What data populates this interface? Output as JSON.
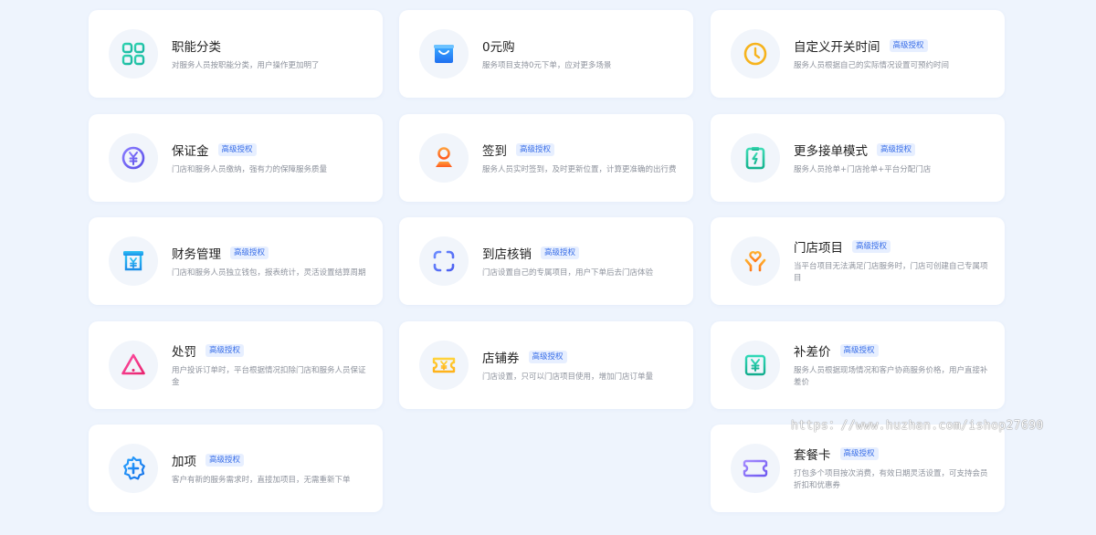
{
  "features": [
    {
      "title": "职能分类",
      "badge": "",
      "desc": "对服务人员按职能分类，用户操作更加明了",
      "icon": "grid-icon"
    },
    {
      "title": "0元购",
      "badge": "",
      "desc": "服务项目支持0元下单，应对更多场景",
      "icon": "bag-icon"
    },
    {
      "title": "自定义开关时间",
      "badge": "高级授权",
      "desc": "服务人员根据自己的实际情况设置可预约时间",
      "icon": "clock-icon"
    },
    {
      "title": "保证金",
      "badge": "高级授权",
      "desc": "门店和服务人员缴纳，强有力的保障服务质量",
      "icon": "yuan-coin-icon"
    },
    {
      "title": "签到",
      "badge": "高级授权",
      "desc": "服务人员实时签到，及时更新位置，计算更准确的出行费",
      "icon": "location-pin-icon"
    },
    {
      "title": "更多接单模式",
      "badge": "高级授权",
      "desc": "服务人员抢单+门店抢单+平台分配门店",
      "icon": "clipboard-bolt-icon"
    },
    {
      "title": "财务管理",
      "badge": "高级授权",
      "desc": "门店和服务人员独立钱包，报表统计，灵活设置结算周期",
      "icon": "wallet-yuan-icon"
    },
    {
      "title": "到店核销",
      "badge": "高级授权",
      "desc": "门店设置自己的专属项目，用户下单后去门店体验",
      "icon": "scan-icon"
    },
    {
      "title": "门店项目",
      "badge": "高级授权",
      "desc": "当平台项目无法满足门店服务时，门店可创建自己专属项目",
      "icon": "heart-hands-icon"
    },
    {
      "title": "处罚",
      "badge": "高级授权",
      "desc": "用户投诉订单时，平台根据情况扣除门店和服务人员保证金",
      "icon": "warning-icon"
    },
    {
      "title": "店铺券",
      "badge": "高级授权",
      "desc": "门店设置，只可以门店项目使用，增加门店订单量",
      "icon": "coupon-icon"
    },
    {
      "title": "补差价",
      "badge": "高级授权",
      "desc": "服务人员根据现场情况和客户协商服务价格，用户直接补差价",
      "icon": "price-tag-icon"
    },
    {
      "title": "加项",
      "badge": "高级授权",
      "desc": "客户有新的服务需求时，直接加项目，无需重新下单",
      "icon": "add-badge-icon"
    },
    {
      "title": "套餐卡",
      "badge": "高级授权",
      "desc": "打包多个项目按次消费，有效日期灵活设置，可支持会员折扣和优惠券",
      "icon": "ticket-card-icon"
    }
  ],
  "watermark": "https：//www.huzhan.com/ishop27690"
}
